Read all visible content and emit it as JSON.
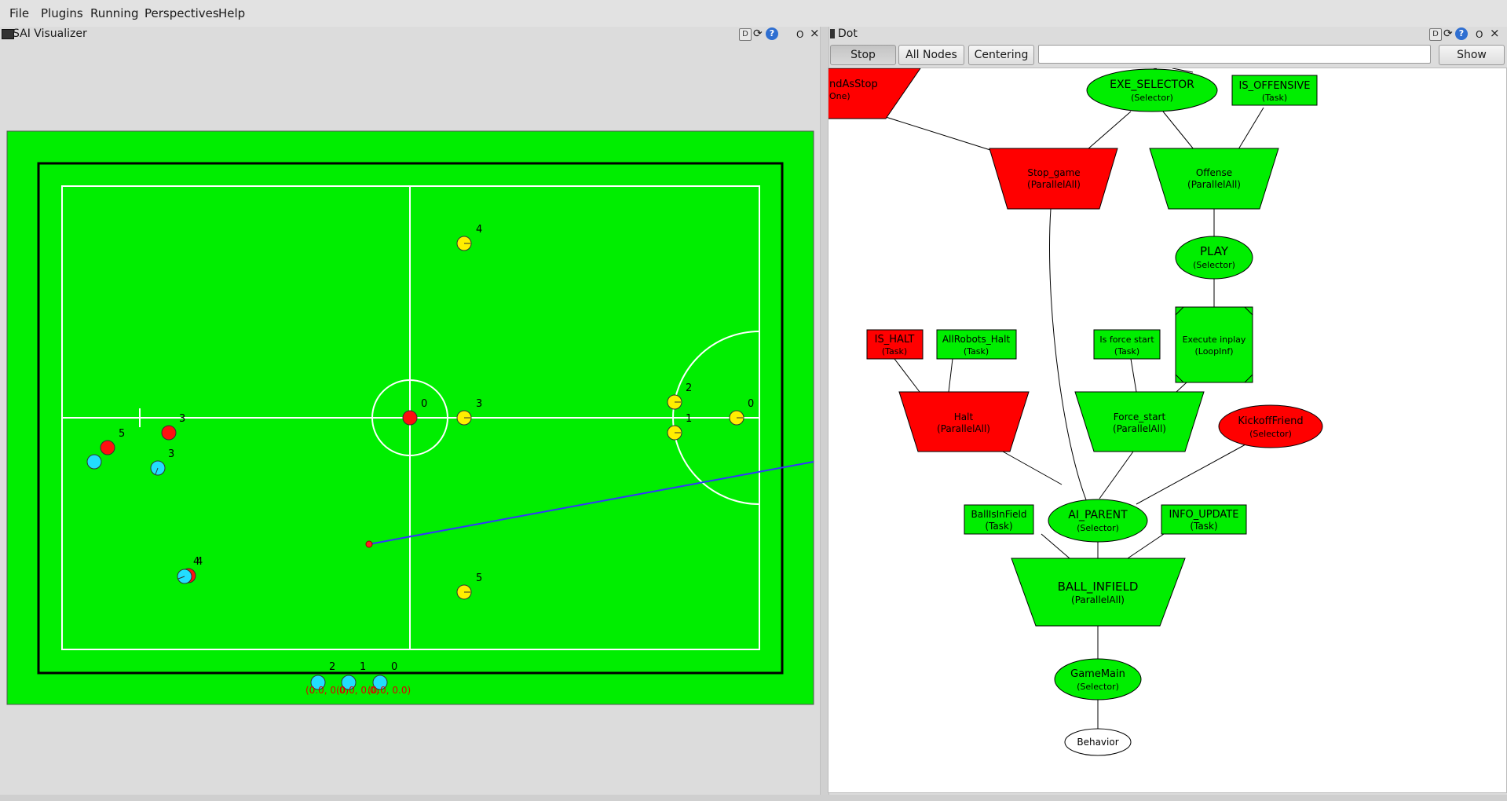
{
  "menubar": {
    "items": [
      "File",
      "Plugins",
      "Running",
      "Perspectives",
      "Help"
    ]
  },
  "left_panel": {
    "title": "SAI Visualizer",
    "controls": {
      "d": "D",
      "help": "?",
      "minimize": "O",
      "close": "×"
    }
  },
  "right_panel": {
    "title": "Dot",
    "controls": {
      "d": "D",
      "help": "?",
      "minimize": "O",
      "close": "×"
    },
    "toolbar": {
      "stop_label": "Stop",
      "all_nodes_label": "All Nodes",
      "centering_label": "Centering",
      "search_value": "",
      "show_label": "Show"
    }
  },
  "field": {
    "colors": {
      "grass": "#00ee00",
      "line": "#ffffff",
      "border": "#000000",
      "pass_line": "#3333ff"
    },
    "yellow_robots": [
      {
        "id": "4",
        "label": "4"
      },
      {
        "id": "3",
        "label": "3"
      },
      {
        "id": "2",
        "label": "2"
      },
      {
        "id": "1",
        "label": "1"
      },
      {
        "id": "0",
        "label": "0"
      },
      {
        "id": "5",
        "label": "5"
      }
    ],
    "blue_robots_field": [
      {
        "id": "3",
        "label": "3"
      },
      {
        "id": "4",
        "label": "4"
      }
    ],
    "red_robots": [
      {
        "id": "3",
        "label": "3"
      },
      {
        "id": "5",
        "label": "5"
      },
      {
        "id": "4",
        "label": "4"
      },
      {
        "id": "0",
        "label": "0"
      }
    ],
    "bench_robots": [
      {
        "label": "2",
        "coord": "(0.0, 0.0)"
      },
      {
        "label": "1",
        "coord": "(0.0, 0.0)"
      },
      {
        "label": "0",
        "coord": "(0.0, 0.0)"
      }
    ]
  },
  "behavior_tree": {
    "colors": {
      "success": "#00ee00",
      "failure": "#ff0000",
      "idle": "#ffffff"
    },
    "nodes": {
      "standasstop": {
        "name": "ndAsStop",
        "type": "One)"
      },
      "exe_selector": {
        "name": "EXE_SELECTOR",
        "type": "(Selector)"
      },
      "is_offensive": {
        "name": "IS_OFFENSIVE",
        "type": "(Task)"
      },
      "stop_game": {
        "name": "Stop_game",
        "type": "(ParallelAll)"
      },
      "offense": {
        "name": "Offense",
        "type": "(ParallelAll)"
      },
      "play": {
        "name": "PLAY",
        "type": "(Selector)"
      },
      "is_halt": {
        "name": "IS_HALT",
        "type": "(Task)"
      },
      "allrobots_halt": {
        "name": "AllRobots_Halt",
        "type": "(Task)"
      },
      "is_force_start": {
        "name": "Is force start",
        "type": "(Task)"
      },
      "execute_inplay": {
        "name": "Execute inplay",
        "type": "(LoopInf)"
      },
      "halt": {
        "name": "Halt",
        "type": "(ParallelAll)"
      },
      "force_start": {
        "name": "Force_start",
        "type": "(ParallelAll)"
      },
      "kickoff_friend": {
        "name": "KickoffFriend",
        "type": "(Selector)"
      },
      "ballisinfield": {
        "name": "BallIsInField",
        "type": "(Task)"
      },
      "ai_parent": {
        "name": "AI_PARENT",
        "type": "(Selector)"
      },
      "info_update": {
        "name": "INFO_UPDATE",
        "type": "(Task)"
      },
      "ball_infield": {
        "name": "BALL_INFIELD",
        "type": "(ParallelAll)"
      },
      "gamemain": {
        "name": "GameMain",
        "type": "(Selector)"
      },
      "behavior": {
        "name": "Behavior"
      }
    }
  }
}
